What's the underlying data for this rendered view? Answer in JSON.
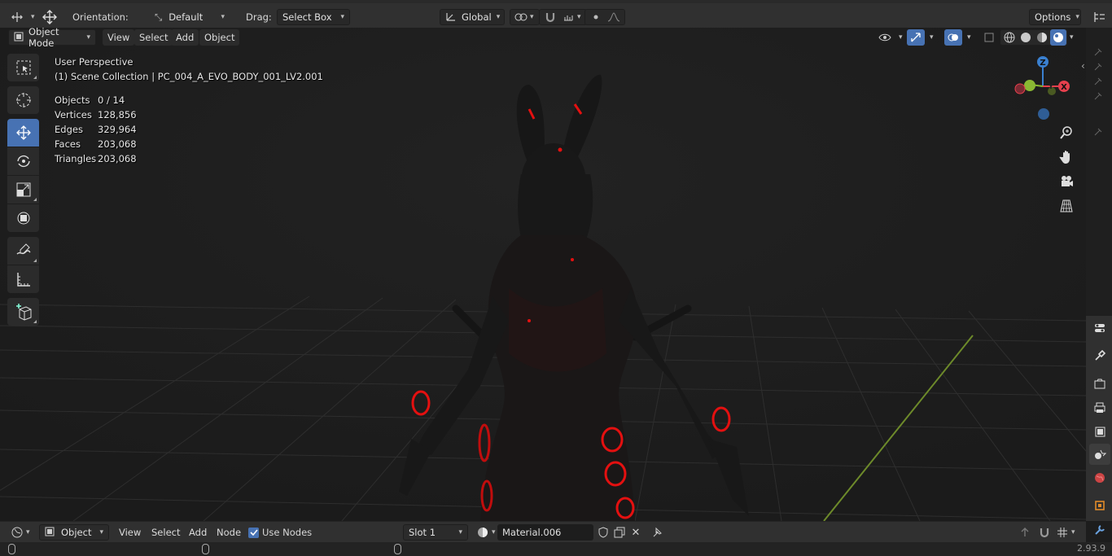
{
  "top_header": {
    "orientation_label": "Orientation:",
    "orientation_value": "Default",
    "drag_label": "Drag:",
    "drag_value": "Select Box",
    "transform_orientation": "Global",
    "options_label": "Options"
  },
  "viewport_header": {
    "mode": "Object Mode",
    "menus": [
      "View",
      "Select",
      "Add",
      "Object"
    ]
  },
  "overlay": {
    "view_name": "User Perspective",
    "collection": "(1) Scene Collection | PC_004_A_EVO_BODY_001_LV2.001",
    "stats": [
      {
        "label": "Objects",
        "value": "0 / 14"
      },
      {
        "label": "Vertices",
        "value": "128,856"
      },
      {
        "label": "Edges",
        "value": "329,964"
      },
      {
        "label": "Faces",
        "value": "203,068"
      },
      {
        "label": "Triangles",
        "value": "203,068"
      }
    ]
  },
  "gizmo": {
    "x": "X",
    "y": "Y",
    "z": "Z"
  },
  "bottom_header": {
    "object_type": "Object",
    "menus": [
      "View",
      "Select",
      "Add",
      "Node"
    ],
    "use_nodes_label": "Use Nodes",
    "slot": "Slot 1",
    "material": "Material.006"
  },
  "status_bar": {
    "version": "2.93.9"
  },
  "colors": {
    "accent": "#4772b3",
    "panel": "#303030",
    "viewport": "#1f1f1f",
    "axis_x": "#e5404d",
    "axis_y": "#8ab833",
    "axis_z": "#3a80d0",
    "glow": "#e41010"
  }
}
